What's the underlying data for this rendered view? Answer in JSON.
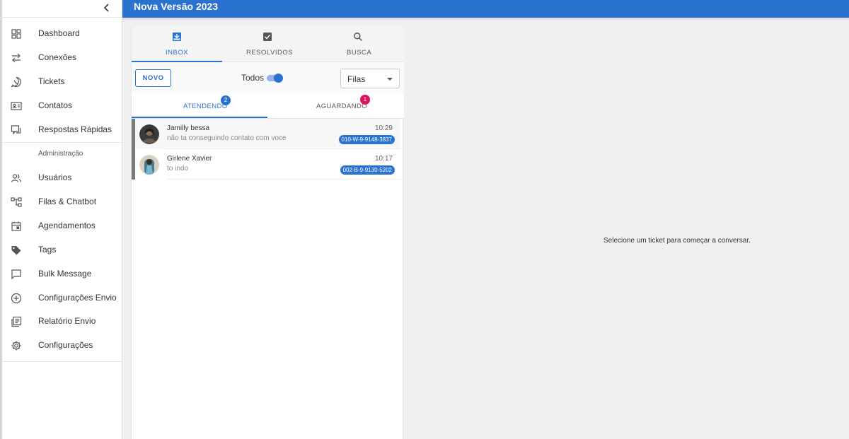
{
  "app": {
    "title": "Nova Versão 2023"
  },
  "sidebar": {
    "section_label": "Administração",
    "items": [
      {
        "label": "Dashboard",
        "icon": "dashboard-icon"
      },
      {
        "label": "Conexões",
        "icon": "swap-icon"
      },
      {
        "label": "Tickets",
        "icon": "whatsapp-icon"
      },
      {
        "label": "Contatos",
        "icon": "contact-card-icon"
      },
      {
        "label": "Respostas Rápidas",
        "icon": "quick-reply-icon"
      },
      {
        "label": "Usuários",
        "icon": "people-icon"
      },
      {
        "label": "Filas & Chatbot",
        "icon": "flow-icon"
      },
      {
        "label": "Agendamentos",
        "icon": "calendar-icon"
      },
      {
        "label": "Tags",
        "icon": "tag-icon"
      },
      {
        "label": "Bulk Message",
        "icon": "message-icon"
      },
      {
        "label": "Configurações Envio",
        "icon": "add-circle-icon"
      },
      {
        "label": "Relatório Envio",
        "icon": "report-icon"
      },
      {
        "label": "Configurações",
        "icon": "gear-icon"
      }
    ]
  },
  "tickets": {
    "tabs": [
      {
        "label": "INBOX",
        "icon": "inbox-icon"
      },
      {
        "label": "RESOLVIDOS",
        "icon": "check-box-icon"
      },
      {
        "label": "BUSCA",
        "icon": "search-icon"
      }
    ],
    "new_button": "NOVO",
    "toggle_label": "Todos",
    "queue_select": "Filas",
    "subtabs": [
      {
        "label": "ATENDENDO",
        "badge": "2"
      },
      {
        "label": "AGUARDANDO",
        "badge": "1"
      }
    ],
    "list": [
      {
        "name": "Jamilly bessa",
        "message": "não ta conseguindo contato com voce",
        "time": "10:29",
        "tag": "010-W-9-9148-3837"
      },
      {
        "name": "Girlene Xavier",
        "message": "to indo",
        "time": "10:17",
        "tag": "002-B-9-9130-5202"
      }
    ]
  },
  "conversation": {
    "placeholder": "Selecione um ticket para começar a conversar."
  },
  "colors": {
    "primary": "#2a72cf",
    "badge_alert": "#e0115f",
    "background": "#f0f0f0"
  }
}
